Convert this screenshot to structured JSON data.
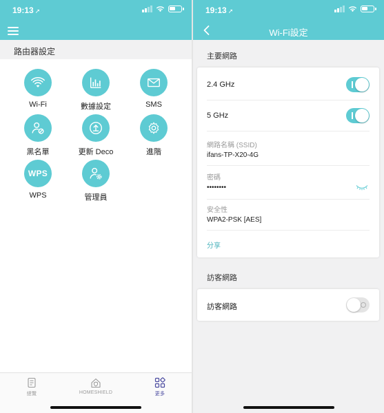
{
  "status_bar": {
    "time": "19:13",
    "location_glyph": "➚"
  },
  "left": {
    "section_title": "路由器設定",
    "tiles": [
      {
        "label": "Wi-Fi",
        "icon": "wifi-icon"
      },
      {
        "label": "數據設定",
        "icon": "bar-chart-icon"
      },
      {
        "label": "SMS",
        "icon": "envelope-icon"
      },
      {
        "label": "黑名單",
        "icon": "blocked-user-icon"
      },
      {
        "label": "更新 Deco",
        "icon": "update-icon"
      },
      {
        "label": "進階",
        "icon": "gear-icon"
      },
      {
        "label": "WPS",
        "icon": "wps-icon",
        "icon_text": "WPS"
      },
      {
        "label": "管理員",
        "icon": "admin-user-icon"
      }
    ],
    "tabbar": [
      {
        "label": "總覽",
        "icon": "document-icon",
        "active": false
      },
      {
        "label": "HOMESHIELD",
        "icon": "home-shield-icon",
        "active": false
      },
      {
        "label": "更多",
        "icon": "grid-icon",
        "active": true
      }
    ]
  },
  "right": {
    "title": "Wi-Fi設定",
    "primary_section_label": "主要網路",
    "band_24": {
      "label": "2.4 GHz",
      "enabled": true
    },
    "band_5": {
      "label": "5 GHz",
      "enabled": true
    },
    "ssid": {
      "label": "網路名稱 (SSID)",
      "value": "ifans-TP-X20-4G"
    },
    "password": {
      "label": "密碼",
      "value": "••••••••",
      "icon": "eye-closed-icon"
    },
    "security": {
      "label": "安全性",
      "value": "WPA2-PSK [AES]"
    },
    "share_label": "分享",
    "guest_section_label": "訪客網路",
    "guest": {
      "label": "訪客網路",
      "enabled": false
    }
  },
  "colors": {
    "accent": "#5ecbd3",
    "link": "#4ab3bc",
    "active_tab": "#4a4aa0"
  }
}
